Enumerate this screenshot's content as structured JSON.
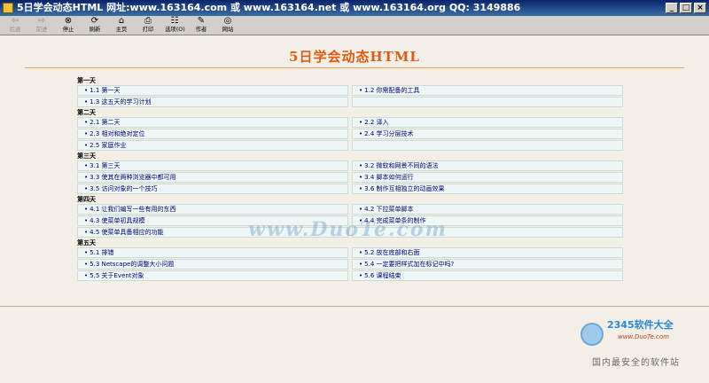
{
  "window": {
    "title": "5日学会动态HTML 网址:www.163164.com 或 www.163164.net 或 www.163164.org  QQ: 3149886",
    "min": "_",
    "max": "□",
    "close": "×"
  },
  "toolbar": [
    {
      "label": "后退",
      "icon": "back-icon",
      "glyph": "⇦",
      "disabled": true
    },
    {
      "label": "前进",
      "icon": "forward-icon",
      "glyph": "⇨",
      "disabled": true
    },
    {
      "label": "停止",
      "icon": "stop-icon",
      "glyph": "⊗",
      "disabled": false
    },
    {
      "label": "刷新",
      "icon": "refresh-icon",
      "glyph": "⟳",
      "disabled": false
    },
    {
      "label": "主页",
      "icon": "home-icon",
      "glyph": "⌂",
      "disabled": false
    },
    {
      "label": "打印",
      "icon": "print-icon",
      "glyph": "⎙",
      "disabled": false
    },
    {
      "label": "选项(O)",
      "icon": "options-icon",
      "glyph": "☷",
      "disabled": false
    },
    {
      "label": "作者",
      "icon": "author-icon",
      "glyph": "✎",
      "disabled": false
    },
    {
      "label": "网站",
      "icon": "website-icon",
      "glyph": "◎",
      "disabled": false
    }
  ],
  "page": {
    "title": "5日学会动态HTML",
    "days": [
      {
        "name": "第一天",
        "items": [
          "1.1 第一天",
          "1.2 你需配备的工具",
          "1.3 这五天的学习计划"
        ]
      },
      {
        "name": "第二天",
        "items": [
          "2.1 第二天",
          "2.2 译入",
          "2.3 相对和绝对定位",
          "2.4 学习分层技术",
          "2.5 家庭作业"
        ]
      },
      {
        "name": "第三天",
        "items": [
          "3.1 第三天",
          "3.2 微软和网景不同的语法",
          "3.3 使其在两种浏览器中都可用",
          "3.4 脚本如何运行",
          "3.5 访问对象的一个技巧",
          "3.6 制作互相独立的动画效果"
        ]
      },
      {
        "name": "第四天",
        "items": [
          "4.1 让我们编写一些有用的东西",
          "4.2 下拉菜单脚本",
          "4.3 使菜单初具规模",
          "4.4 完成菜单条的制作",
          "4.5 使菜单具备相应的功能"
        ]
      },
      {
        "name": "第五天",
        "items": [
          "5.1 排错",
          "5.2 放在底部和右面",
          "5.3 Netscape的调整大小问题",
          "5.4 一定要把样式加在标记中吗?",
          "5.5 关于Event对象",
          "5.6 课程结束"
        ]
      }
    ]
  },
  "watermark": "www.DuoTe.com",
  "corner_logo": {
    "brand": "2345软件大全",
    "url": "www.DuoTe.com",
    "slogan": "国内最安全的软件站"
  }
}
